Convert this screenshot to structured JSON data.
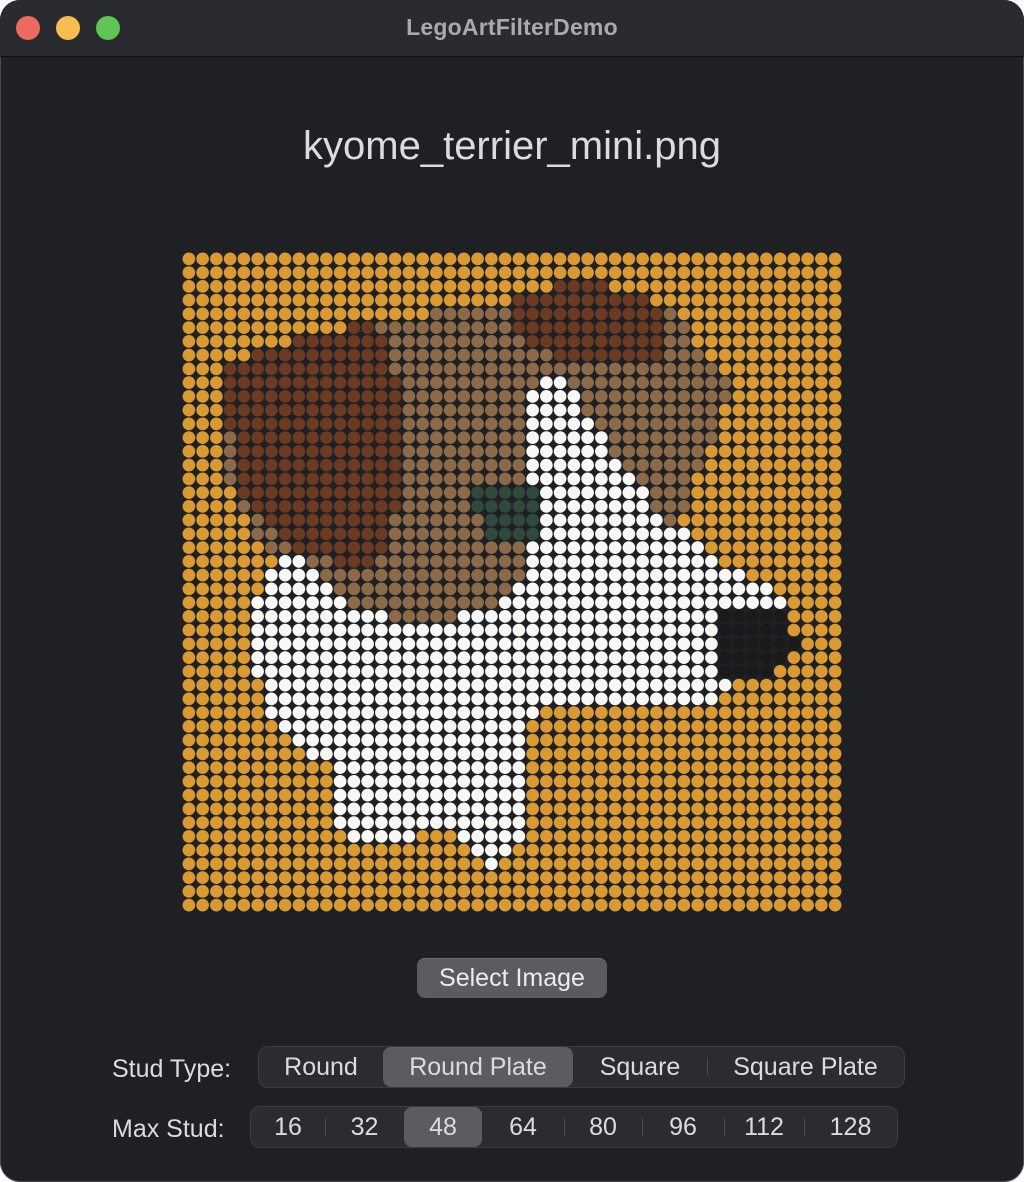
{
  "window": {
    "title": "LegoArtFilterDemo"
  },
  "file_name": "kyome_terrier_mini.png",
  "preview": {
    "alt": "LEGO mosaic preview of terrier",
    "grid": 48
  },
  "select_button": {
    "label": "Select Image"
  },
  "stud_type": {
    "label": "Stud Type:",
    "options": [
      "Round",
      "Round Plate",
      "Square",
      "Square Plate"
    ],
    "selected": "Round Plate"
  },
  "max_stud": {
    "label": "Max Stud:",
    "options": [
      "16",
      "32",
      "48",
      "64",
      "80",
      "96",
      "112",
      "128"
    ],
    "selected": "48"
  },
  "colors": {
    "background": "#1f2023",
    "stud_orange": "#d99a34",
    "stud_white": "#f7f7f5",
    "stud_brown_dark": "#6b3a22",
    "stud_brown_mid": "#8b6a4a",
    "stud_green": "#2f4a3c",
    "stud_black": "#1a1a1a"
  }
}
